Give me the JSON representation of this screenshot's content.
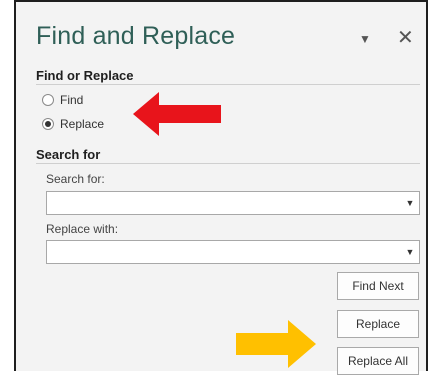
{
  "dialog": {
    "title": "Find and Replace",
    "dropdown_glyph": "▼",
    "close_glyph": "✕"
  },
  "find_or_replace": {
    "heading": "Find or Replace",
    "options": [
      {
        "label": "Find",
        "checked": false
      },
      {
        "label": "Replace",
        "checked": true
      }
    ]
  },
  "search": {
    "heading": "Search for",
    "search_label": "Search for:",
    "search_value": "",
    "replace_label": "Replace with:",
    "replace_value": ""
  },
  "buttons": {
    "find_next": "Find Next",
    "replace": "Replace",
    "replace_all": "Replace All"
  },
  "annotations": {
    "red_arrow_color": "#e8141b",
    "yellow_arrow_color": "#ffc000"
  },
  "icons": [
    "dropdown-icon",
    "close-icon",
    "combo-arrow-icon"
  ]
}
